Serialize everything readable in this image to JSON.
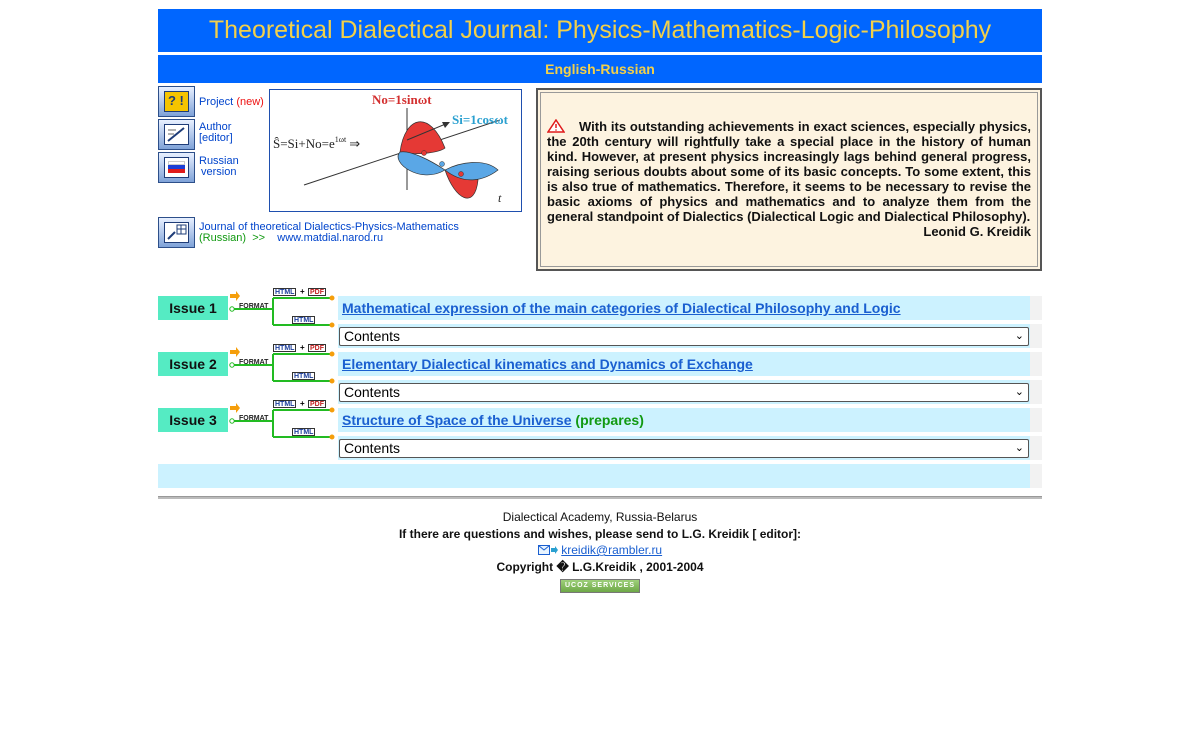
{
  "header": {
    "title": "Theoretical Dialectical Journal: Physics-Mathematics-Logic-Philosophy",
    "language": "English-Russian"
  },
  "nav": {
    "project": {
      "label": "Project",
      "tag": "(new)"
    },
    "author": {
      "label": "Author",
      "sub": "[editor]"
    },
    "russian": {
      "label": "Russian",
      "sub": "version"
    },
    "journal": {
      "line1": "Journal of theoretical Dialectics-Physics-Mathematics",
      "russian": "(Russian)",
      "arrows": ">>",
      "site": "www.matdial.narod.ru"
    }
  },
  "illustration": {
    "eq_no": "No=1sinωt",
    "eq_si": "Si=1cosωt",
    "eq_main": "Ŝ=Si+No=e",
    "eq_exp": "1ωt",
    "arrow": "⇒",
    "axis_t": "t"
  },
  "quote": {
    "text": "With its outstanding achievements in exact sciences, especially physics, the 20th century will rightfully take a special place in the history of human kind. However, at present physics increasingly lags behind general progress, raising serious doubts about some of its basic concepts. To some extent, this is also true of mathematics. Therefore, it seems to be necessary to revise the basic axioms of physics and mathematics and to analyze them from the general standpoint of Dialectics (Dialectical Logic and Dialectical Philosophy).",
    "author": "Leonid G. Kreidik"
  },
  "format_labels": {
    "format": "FORMAT",
    "html": "HTML",
    "plus": "+",
    "pdf": "PDF"
  },
  "issues": [
    {
      "label": "Issue 1",
      "title": "Mathematical expression of the main categories of Dialectical Philosophy and Logic",
      "note": "",
      "select": "Contents"
    },
    {
      "label": "Issue 2",
      "title": "Elementary Dialectical kinematics and Dynamics of Exchange",
      "note": "",
      "select": "Contents"
    },
    {
      "label": "Issue 3",
      "title": "Structure of Space of the Universe",
      "note": "(prepares)",
      "select": "Contents"
    }
  ],
  "footer": {
    "academy": "Dialectical Academy, Russia-Belarus",
    "contact": "If there are questions and wishes, please send to L.G. Kreidik [ editor]:",
    "email": "kreidik@rambler.ru",
    "copyright": "Copyright � L.G.Kreidik , 2001-2004",
    "badge": "UCOZ SERVICES"
  },
  "colors": {
    "accent": "#0066ff",
    "title_text": "#f2d04a",
    "issue_box": "#55ebc3",
    "issue_bar": "#ccf2ff",
    "quote_bg": "#fdf3e0"
  }
}
